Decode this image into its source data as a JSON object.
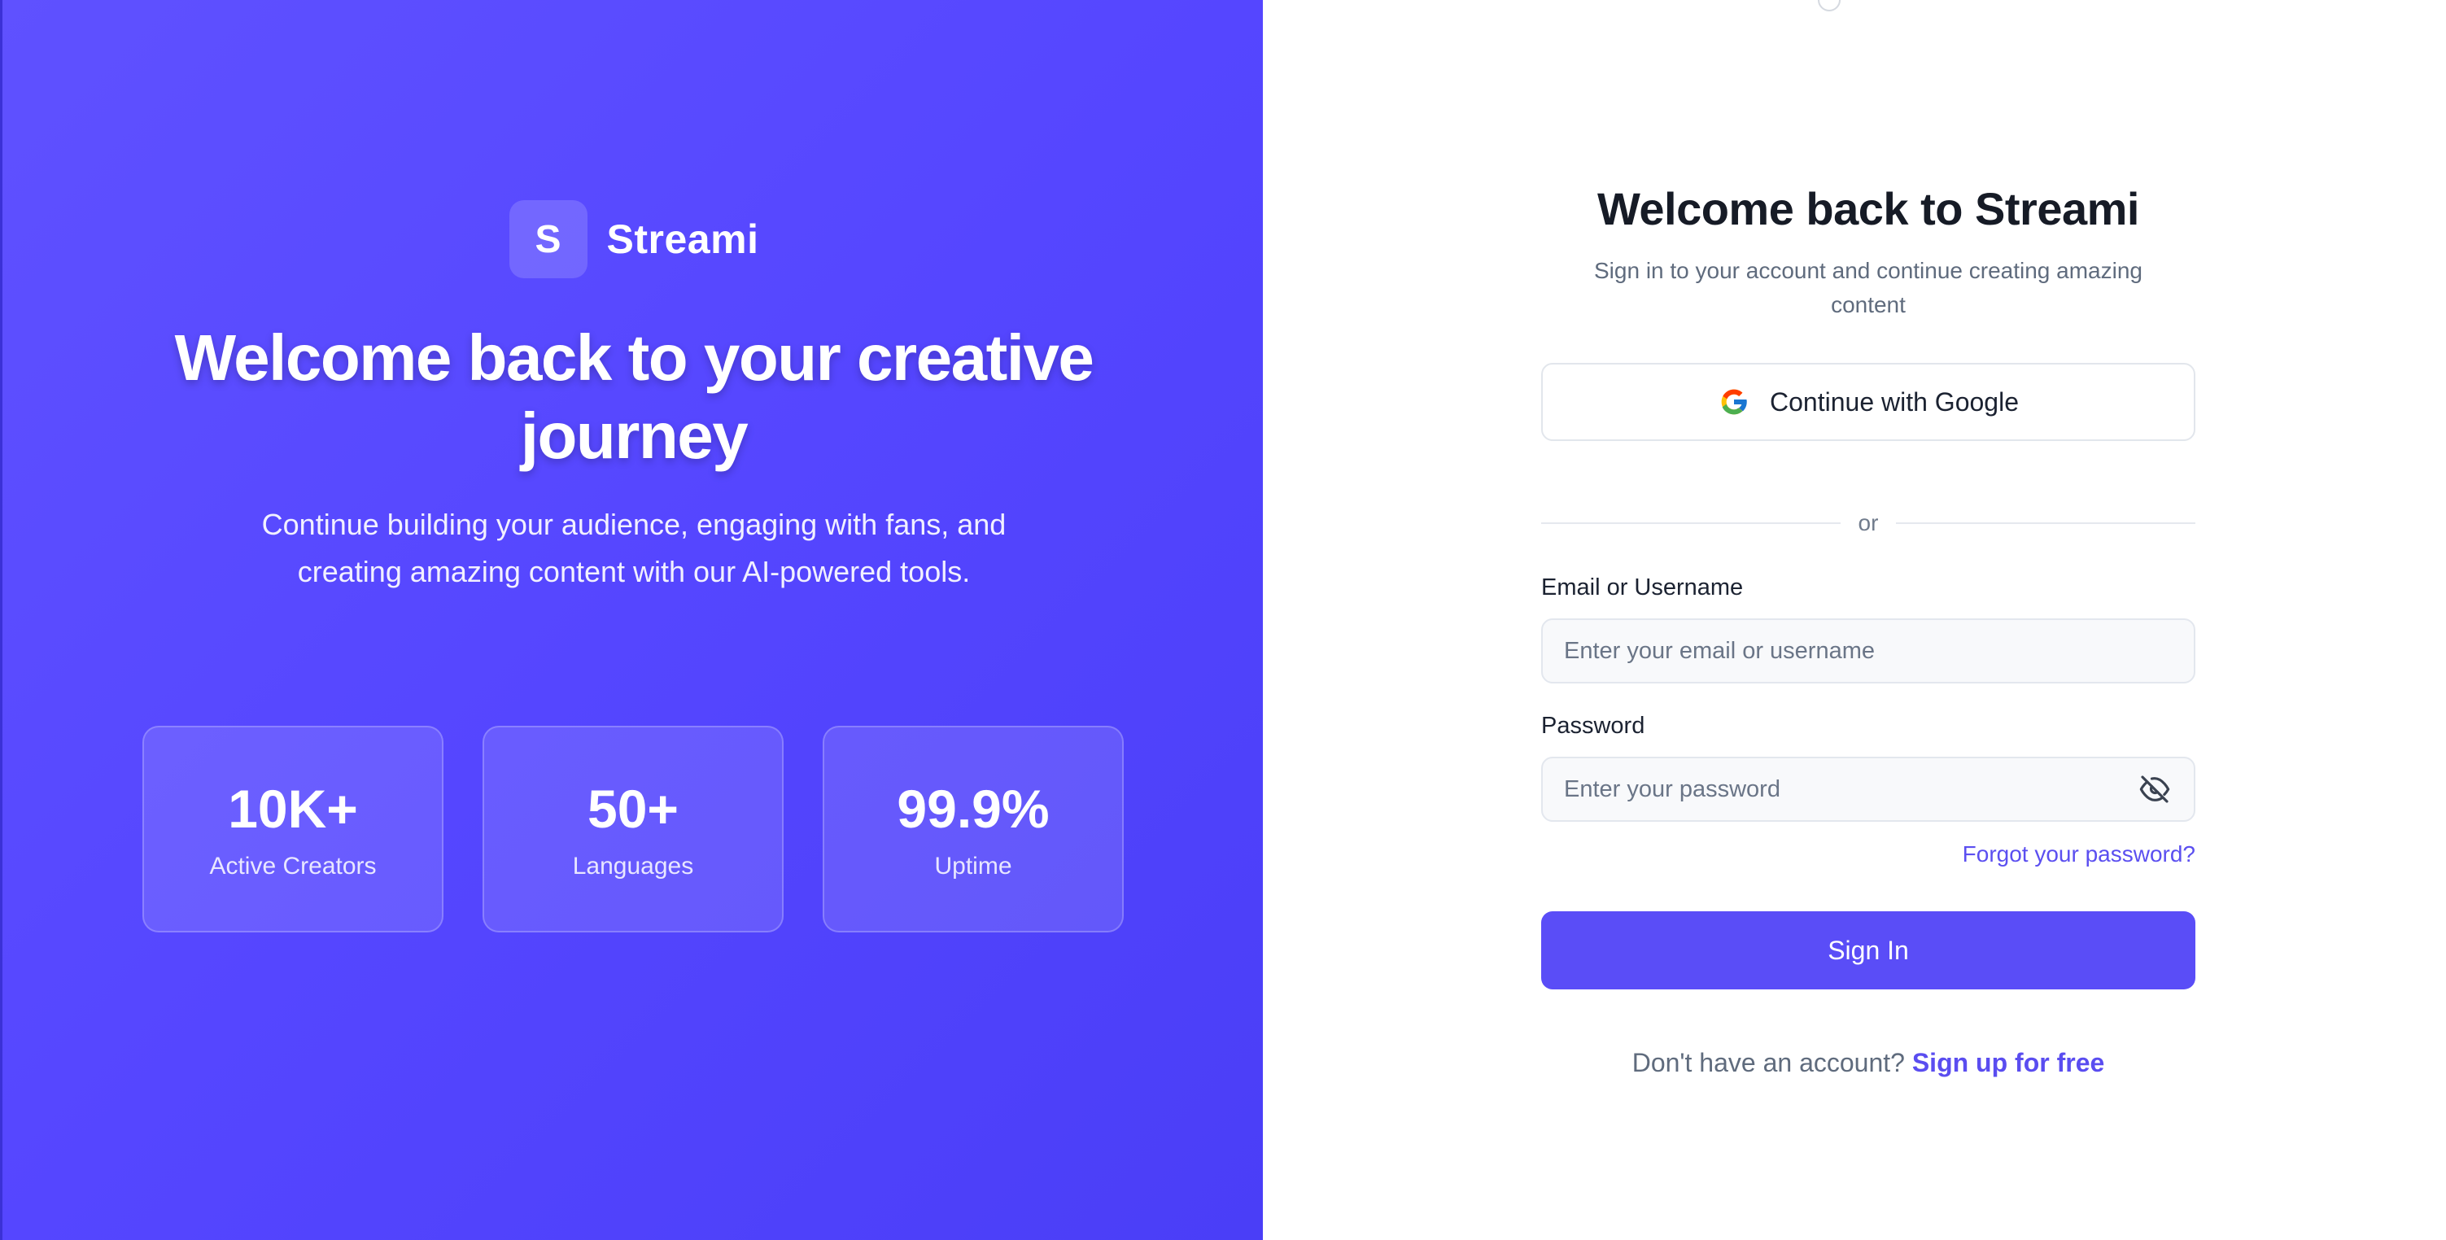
{
  "brand": {
    "logo_letter": "S",
    "name": "Streami"
  },
  "hero": {
    "title": "Welcome back to your creative journey",
    "subtitle": "Continue building your audience, engaging with fans, and creating amazing content with our AI-powered tools.",
    "stats": [
      {
        "value": "10K+",
        "label": "Active Creators"
      },
      {
        "value": "50+",
        "label": "Languages"
      },
      {
        "value": "99.9%",
        "label": "Uptime"
      }
    ]
  },
  "form": {
    "title": "Welcome back to Streami",
    "subtitle": "Sign in to your account and continue creating amazing content",
    "google_button": "Continue with Google",
    "divider": "or",
    "email_label": "Email or Username",
    "email_placeholder": "Enter your email or username",
    "password_label": "Password",
    "password_placeholder": "Enter your password",
    "forgot": "Forgot your password?",
    "submit": "Sign In",
    "signup_prompt": "Don't have an account?",
    "signup_link": "Sign up for free"
  },
  "colors": {
    "hero_bg": "#5546ff",
    "accent": "#5a4df7",
    "heading": "#161b26",
    "muted": "#5f6b7d"
  }
}
